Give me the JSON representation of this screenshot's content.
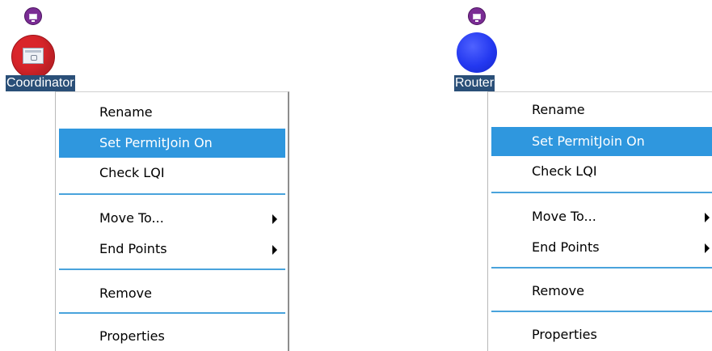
{
  "left_panel": {
    "node_label": "Coordinator",
    "menu": {
      "items": [
        {
          "label": "Rename"
        },
        {
          "label": "Set PermitJoin On"
        },
        {
          "label": "Check LQI"
        },
        {
          "label": "Move To..."
        },
        {
          "label": "End Points"
        },
        {
          "label": "Remove"
        },
        {
          "label": "Properties"
        }
      ]
    }
  },
  "right_panel": {
    "node_label": "Router",
    "menu": {
      "items": [
        {
          "label": "Rename"
        },
        {
          "label": "Set PermitJoin On"
        },
        {
          "label": "Check LQI"
        },
        {
          "label": "Move To..."
        },
        {
          "label": "End Points"
        },
        {
          "label": "Remove"
        },
        {
          "label": "Properties"
        }
      ]
    }
  },
  "colors": {
    "highlight": "#2f97de",
    "separator": "#49a3dc",
    "label_bg": "#2a4f78",
    "coordinator": "#d9252b",
    "router": "#2338f0",
    "node_badge": "#7a2c94"
  },
  "icons": {
    "node_badge": "monitor-badge-icon",
    "coordinator": "coordinator-device-icon",
    "router": "router-sphere-icon",
    "submenu": "submenu-arrow-icon"
  }
}
